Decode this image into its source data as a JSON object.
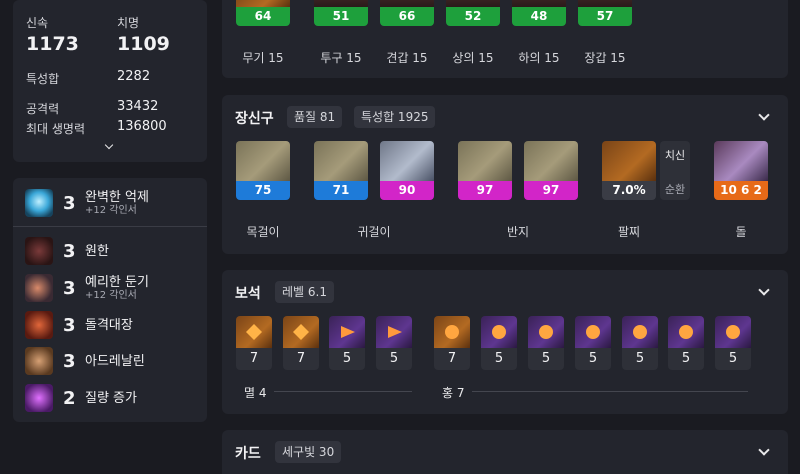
{
  "stats": {
    "swift_label": "신속",
    "swift_value": "1173",
    "crit_label": "치명",
    "crit_value": "1109",
    "total_label": "특성합",
    "total_value": "2282",
    "atk_label": "공격력",
    "atk_value": "33432",
    "hp_label": "최대 생명력",
    "hp_value": "136800"
  },
  "engravings": [
    {
      "level": "3",
      "name": "완벽한 억제",
      "sub": "+12 각인서"
    },
    {
      "level": "3",
      "name": "원한",
      "sub": ""
    },
    {
      "level": "3",
      "name": "예리한 둔기",
      "sub": "+12 각인서"
    },
    {
      "level": "3",
      "name": "돌격대장",
      "sub": ""
    },
    {
      "level": "3",
      "name": "아드레날린",
      "sub": ""
    },
    {
      "level": "2",
      "name": "질량 증가",
      "sub": ""
    }
  ],
  "equipment": {
    "items": [
      {
        "value": "64",
        "label": "무기 15"
      },
      {
        "value": "51",
        "label": "투구 15"
      },
      {
        "value": "66",
        "label": "견갑 15"
      },
      {
        "value": "52",
        "label": "상의 15"
      },
      {
        "value": "48",
        "label": "하의 15"
      },
      {
        "value": "57",
        "label": "장갑 15"
      }
    ]
  },
  "accessories": {
    "title": "장신구",
    "quality_chip": "품질 81",
    "stat_chip": "특성합 1925",
    "values": [
      "75",
      "71",
      "90",
      "97",
      "97"
    ],
    "labels": {
      "necklace": "목걸이",
      "earring": "귀걸이",
      "ring": "반지",
      "bracelet": "팔찌",
      "stone": "돌"
    },
    "bracelet_value": "7.0%",
    "bracelet_stat1": "치신",
    "bracelet_stat2": "순환",
    "stone_value": "10 6 2"
  },
  "gems": {
    "title": "보석",
    "level_chip": "레벨 6.1",
    "left": [
      "7",
      "7",
      "5",
      "5"
    ],
    "right": [
      "7",
      "5",
      "5",
      "5",
      "5",
      "5",
      "5"
    ],
    "left_label": "멸 4",
    "right_label": "홍 7"
  },
  "cards": {
    "title": "카드",
    "chip": "세구빛 30"
  },
  "colors": {
    "panel": "#23252d",
    "background": "#1a1b21",
    "quality_blue": "#1e7bd9",
    "quality_pink": "#d225c8",
    "quality_green": "#1ea03c",
    "stone_orange": "#e76a18"
  }
}
